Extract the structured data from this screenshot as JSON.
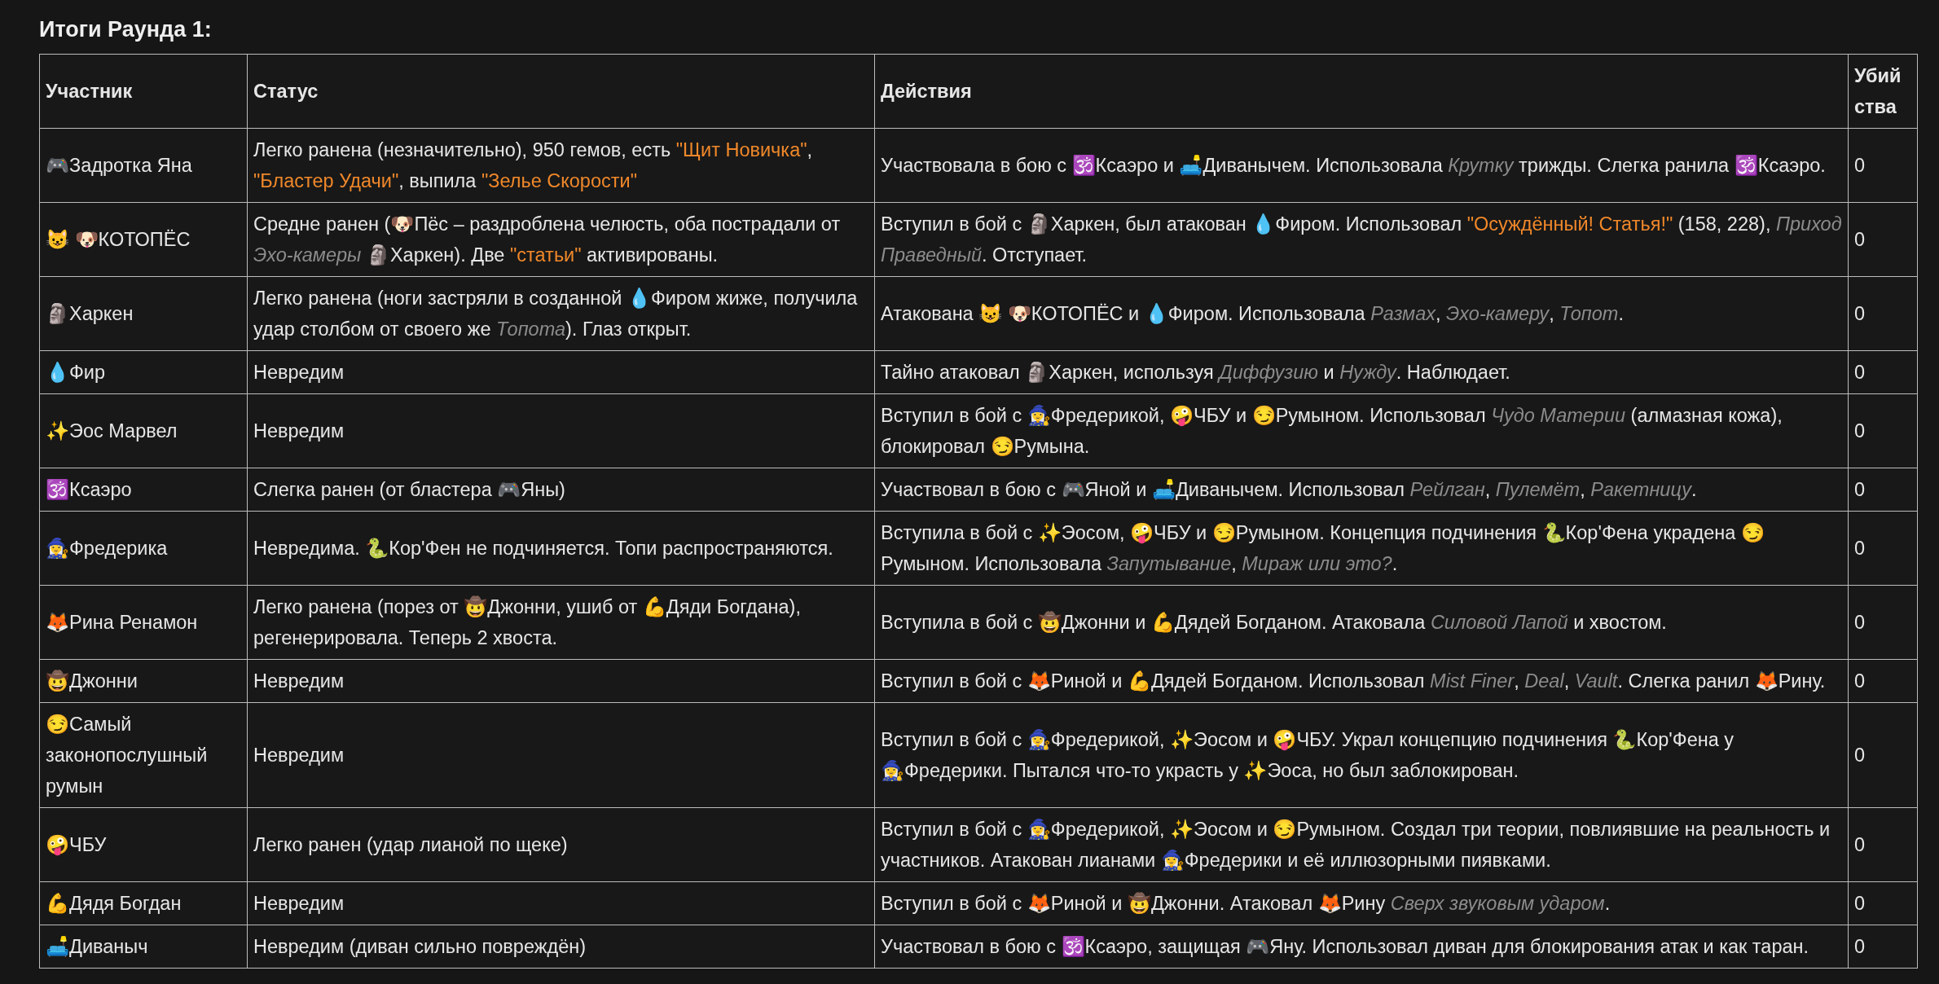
{
  "title": "Итоги Раунда 1:",
  "table": {
    "columns": [
      "Участник",
      "Статус",
      "Действия",
      "Убийства"
    ],
    "rows": [
      {
        "participant": "🎮Задротка Яна",
        "status": [
          {
            "kind": "plain",
            "text": "Легко ранена (незначительно), 950 гемов, есть "
          },
          {
            "kind": "quote",
            "text": "\"Щит Новичка\""
          },
          {
            "kind": "plain",
            "text": ", "
          },
          {
            "kind": "quote",
            "text": "\"Бластер Удачи\""
          },
          {
            "kind": "plain",
            "text": ", выпила "
          },
          {
            "kind": "quote",
            "text": "\"Зелье Скорости\""
          }
        ],
        "actions": [
          {
            "kind": "plain",
            "text": "Участвовала в бою с 🕉️Ксаэро и 🛋️Диванычем. Использовала *Крутку* трижды. Слегка ранила 🕉️Ксаэро."
          }
        ],
        "kills": "0"
      },
      {
        "participant": "😺 🐶КОТОПЁС",
        "status": [
          {
            "kind": "plain",
            "text": "Средне ранен (🐶Пёс – раздроблена челюсть, оба пострадали от *Эхо-камеры* 🗿Харкен). Две "
          },
          {
            "kind": "quote",
            "text": "\"статьи\""
          },
          {
            "kind": "plain",
            "text": " активированы."
          }
        ],
        "actions": [
          {
            "kind": "plain",
            "text": "Вступил в бой с 🗿Харкен, был атакован 💧Фиром. Использовал "
          },
          {
            "kind": "quote",
            "text": "\"Осуждённый! Статья!\""
          },
          {
            "kind": "plain",
            "text": " (158, 228), *Приход Праведный*. Отступает."
          }
        ],
        "kills": "0"
      },
      {
        "participant": "🗿Харкен",
        "status": [
          {
            "kind": "plain",
            "text": "Легко ранена (ноги застряли в созданной 💧Фиром жиже, получила удар столбом от своего же *Топота*). Глаз открыт."
          }
        ],
        "actions": [
          {
            "kind": "plain",
            "text": "Атакована 😺 🐶КОТОПЁС и 💧Фиром. Использовала *Размах*, *Эхо-камеру*, *Топот*."
          }
        ],
        "kills": "0"
      },
      {
        "participant": "💧Фир",
        "status": [
          {
            "kind": "plain",
            "text": "Невредим"
          }
        ],
        "actions": [
          {
            "kind": "plain",
            "text": "Тайно атаковал 🗿Харкен, используя *Диффузию* и *Нужду*. Наблюдает."
          }
        ],
        "kills": "0"
      },
      {
        "participant": "✨Эос Марвел",
        "status": [
          {
            "kind": "plain",
            "text": "Невредим"
          }
        ],
        "actions": [
          {
            "kind": "plain",
            "text": "Вступил в бой с 🧙‍♀️Фредерикой, 🤪ЧБУ и 😏Румыном. Использовал *Чудо Материи* (алмазная кожа), блокировал 😏Румына."
          }
        ],
        "kills": "0"
      },
      {
        "participant": "🕉️Ксаэро",
        "status": [
          {
            "kind": "plain",
            "text": "Слегка ранен (от бластера 🎮Яны)"
          }
        ],
        "actions": [
          {
            "kind": "plain",
            "text": "Участвовал в бою с 🎮Яной и 🛋️Диванычем. Использовал *Рейлган*, *Пулемёт*, *Ракетницу*."
          }
        ],
        "kills": "0"
      },
      {
        "participant": "🧙‍♀️Фредерика",
        "status": [
          {
            "kind": "plain",
            "text": "Невредима. 🐍Кор'Фен не подчиняется. Топи распространяются."
          }
        ],
        "actions": [
          {
            "kind": "plain",
            "text": "Вступила в бой с ✨Эосом, 🤪ЧБУ и 😏Румыном. Концепция подчинения 🐍Кор'Фена украдена 😏Румыном. Использовала *Запутывание*, *Мираж или это?*."
          }
        ],
        "kills": "0"
      },
      {
        "participant": "🦊Рина Ренамон",
        "status": [
          {
            "kind": "plain",
            "text": "Легко ранена (порез от 🤠Джонни, ушиб от 💪Дяди Богдана), регенерировала. Теперь 2 хвоста."
          }
        ],
        "actions": [
          {
            "kind": "plain",
            "text": "Вступила в бой с 🤠Джонни и 💪Дядей Богданом. Атаковала *Силовой Лапой* и хвостом."
          }
        ],
        "kills": "0"
      },
      {
        "participant": "🤠Джонни",
        "status": [
          {
            "kind": "plain",
            "text": "Невредим"
          }
        ],
        "actions": [
          {
            "kind": "plain",
            "text": "Вступил в бой с 🦊Риной и 💪Дядей Богданом. Использовал *Mist Finer*, *Deal*, *Vault*. Слегка ранил 🦊Рину."
          }
        ],
        "kills": "0"
      },
      {
        "participant": "😏Самый законопослушный румын",
        "status": [
          {
            "kind": "plain",
            "text": "Невредим"
          }
        ],
        "actions": [
          {
            "kind": "plain",
            "text": "Вступил в бой с 🧙‍♀️Фредерикой, ✨Эосом и 🤪ЧБУ. Украл концепцию подчинения 🐍Кор'Фена у 🧙‍♀️Фредерики. Пытался что-то украсть у ✨Эоса, но был заблокирован."
          }
        ],
        "kills": "0"
      },
      {
        "participant": "🤪ЧБУ",
        "status": [
          {
            "kind": "plain",
            "text": "Легко ранен (удар лианой по щеке)"
          }
        ],
        "actions": [
          {
            "kind": "plain",
            "text": "Вступил в бой с 🧙‍♀️Фредерикой, ✨Эосом и 😏Румыном. Создал три теории, повлиявшие на реальность и участников. Атакован лианами 🧙‍♀️Фредерики и её иллюзорными пиявками."
          }
        ],
        "kills": "0"
      },
      {
        "participant": "💪Дядя Богдан",
        "status": [
          {
            "kind": "plain",
            "text": "Невредим"
          }
        ],
        "actions": [
          {
            "kind": "plain",
            "text": "Вступил в бой с 🦊Риной и 🤠Джонни. Атаковал 🦊Рину *Сверх звуковым ударом*."
          }
        ],
        "kills": "0"
      },
      {
        "participant": "🛋️Диваныч",
        "status": [
          {
            "kind": "plain",
            "text": "Невредим (диван сильно повреждён)"
          }
        ],
        "actions": [
          {
            "kind": "plain",
            "text": "Участвовал в бою с 🕉️Ксаэро, защищая 🎮Яну. Использовал диван для блокирования атак и как таран."
          }
        ],
        "kills": "0"
      }
    ]
  }
}
